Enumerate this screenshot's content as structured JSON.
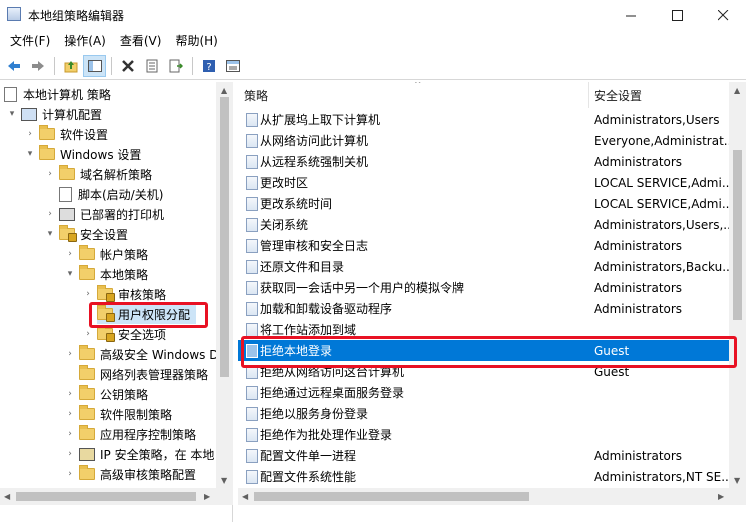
{
  "window": {
    "title": "本地组策略编辑器",
    "controls": [
      "minimize-icon",
      "maximize-icon",
      "close-icon"
    ]
  },
  "menu": [
    "文件(F)",
    "操作(A)",
    "查看(V)",
    "帮助(H)"
  ],
  "toolbar": {
    "icons": [
      "back-arrow-icon",
      "forward-arrow-icon",
      "up-folder-icon",
      "show-hide-tree-icon",
      "delete-icon",
      "properties-icon",
      "export-list-icon",
      "help-icon",
      "view-icon"
    ]
  },
  "tree": {
    "items": [
      {
        "label": "本地计算机 策略",
        "expanded": true,
        "icon": "policy-doc-icon"
      },
      {
        "label": "计算机配置",
        "expanded": true,
        "icon": "computer-icon"
      },
      {
        "label": "软件设置",
        "expanded": false,
        "icon": "folder-icon"
      },
      {
        "label": "Windows 设置",
        "expanded": true,
        "icon": "folder-icon"
      },
      {
        "label": "域名解析策略",
        "expanded": false,
        "icon": "folder-icon"
      },
      {
        "label": "脚本(启动/关机)",
        "expanded": false,
        "icon": "script-icon"
      },
      {
        "label": "已部署的打印机",
        "expanded": false,
        "icon": "printer-icon"
      },
      {
        "label": "安全设置",
        "expanded": true,
        "icon": "security-icon"
      },
      {
        "label": "帐户策略",
        "expanded": false,
        "icon": "folder-icon"
      },
      {
        "label": "本地策略",
        "expanded": true,
        "icon": "folder-icon"
      },
      {
        "label": "审核策略",
        "expanded": false,
        "icon": "folder-lock-icon"
      },
      {
        "label": "用户权限分配",
        "expanded": false,
        "icon": "folder-lock-icon",
        "selected": true
      },
      {
        "label": "安全选项",
        "expanded": false,
        "icon": "folder-lock-icon"
      },
      {
        "label": "高级安全 Windows D",
        "expanded": false,
        "icon": "folder-icon"
      },
      {
        "label": "网络列表管理器策略",
        "expanded": false,
        "icon": "folder-icon"
      },
      {
        "label": "公钥策略",
        "expanded": false,
        "icon": "folder-icon"
      },
      {
        "label": "软件限制策略",
        "expanded": false,
        "icon": "folder-icon"
      },
      {
        "label": "应用程序控制策略",
        "expanded": false,
        "icon": "folder-icon"
      },
      {
        "label": "IP 安全策略，在 本地",
        "expanded": false,
        "icon": "shield-icon"
      },
      {
        "label": "高级审核策略配置",
        "expanded": false,
        "icon": "folder-icon"
      }
    ]
  },
  "list": {
    "columns": [
      "策略",
      "安全设置"
    ],
    "rows": [
      {
        "policy": "从扩展坞上取下计算机",
        "setting": "Administrators,Users"
      },
      {
        "policy": "从网络访问此计算机",
        "setting": "Everyone,Administrat..."
      },
      {
        "policy": "从远程系统强制关机",
        "setting": "Administrators"
      },
      {
        "policy": "更改时区",
        "setting": "LOCAL SERVICE,Admi..."
      },
      {
        "policy": "更改系统时间",
        "setting": "LOCAL SERVICE,Admi..."
      },
      {
        "policy": "关闭系统",
        "setting": "Administrators,Users,..."
      },
      {
        "policy": "管理审核和安全日志",
        "setting": "Administrators"
      },
      {
        "policy": "还原文件和目录",
        "setting": "Administrators,Backu..."
      },
      {
        "policy": "获取同一会话中另一个用户的模拟令牌",
        "setting": "Administrators"
      },
      {
        "policy": "加载和卸载设备驱动程序",
        "setting": "Administrators"
      },
      {
        "policy": "将工作站添加到域",
        "setting": ""
      },
      {
        "policy": "拒绝本地登录",
        "setting": "Guest",
        "selected": true
      },
      {
        "policy": "拒绝从网络访问这台计算机",
        "setting": "Guest"
      },
      {
        "policy": "拒绝通过远程桌面服务登录",
        "setting": ""
      },
      {
        "policy": "拒绝以服务身份登录",
        "setting": ""
      },
      {
        "policy": "拒绝作为批处理作业登录",
        "setting": ""
      },
      {
        "policy": "配置文件单一进程",
        "setting": "Administrators"
      },
      {
        "policy": "配置文件系统性能",
        "setting": "Administrators,NT SE..."
      }
    ]
  },
  "colors": {
    "selection": "#0078d7",
    "tree_selection": "#cce4f7",
    "annotation_box": "#e81123"
  }
}
